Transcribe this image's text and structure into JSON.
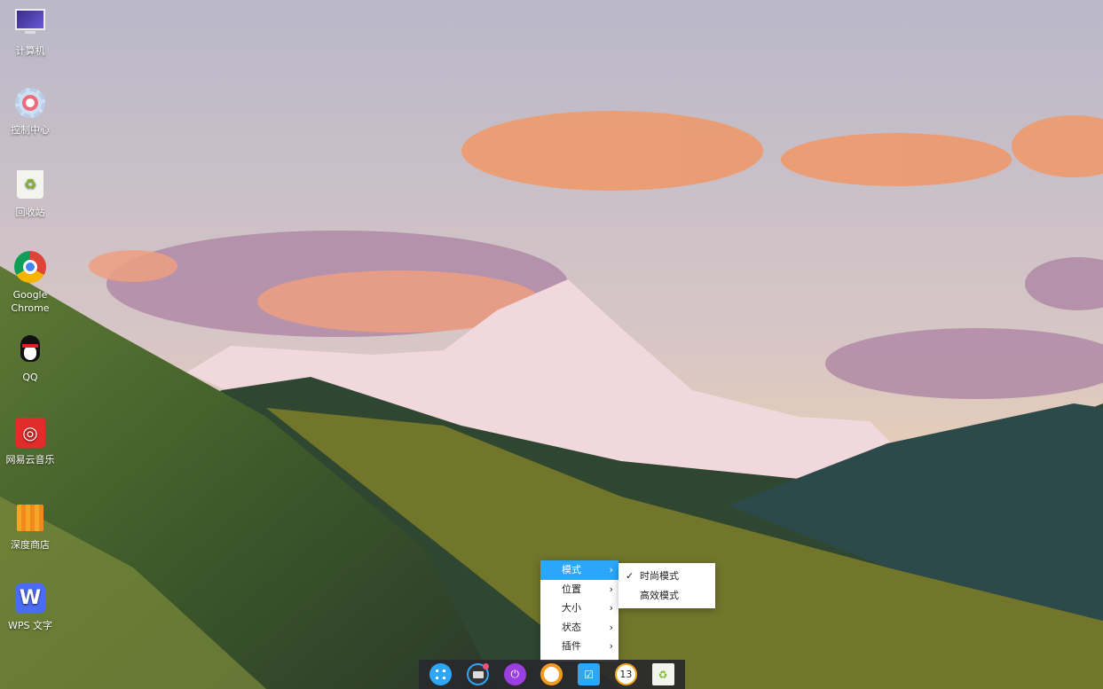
{
  "desktop": {
    "icons": [
      {
        "label": "计算机",
        "icon": "computer-icon"
      },
      {
        "label": "控制中心",
        "icon": "gear-icon"
      },
      {
        "label": "回收站",
        "icon": "trash-icon"
      },
      {
        "label": "Google Chrome",
        "icon": "chrome-icon"
      },
      {
        "label": "QQ",
        "icon": "qq-penguin-icon"
      },
      {
        "label": "网易云音乐",
        "icon": "netease-music-icon"
      },
      {
        "label": "深度商店",
        "icon": "store-bag-icon"
      },
      {
        "label": "WPS 文字",
        "icon": "wps-writer-icon"
      }
    ]
  },
  "context_menu": {
    "items": [
      {
        "label": "模式",
        "selected": true
      },
      {
        "label": "位置"
      },
      {
        "label": "大小"
      },
      {
        "label": "状态"
      },
      {
        "label": "插件"
      }
    ],
    "arrow": "›",
    "submenu": {
      "items": [
        {
          "label": "时尚模式",
          "checked": true
        },
        {
          "label": "高效模式",
          "checked": false
        }
      ],
      "check": "✓"
    }
  },
  "dock": {
    "items": [
      "launcher-icon",
      "keyboard-icon",
      "power-icon",
      "browser-icon",
      "screenshot-icon",
      "clock-icon",
      "trash-icon"
    ],
    "clock_text": "13",
    "accent": "#2ca7f8"
  }
}
